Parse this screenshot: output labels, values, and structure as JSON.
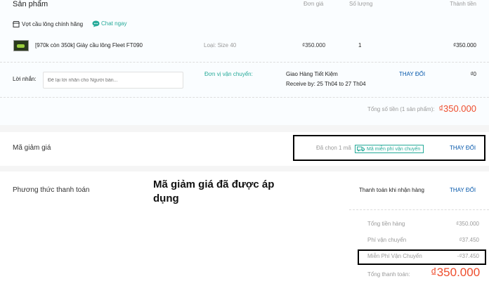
{
  "products": {
    "header": {
      "title": "Sản phẩm",
      "unit_price": "Đơn giá",
      "quantity": "Số lượng",
      "subtotal": "Thành tiền"
    },
    "shop": {
      "name": "Vợt cầu lông chính hãng",
      "chat_label": "Chat ngay"
    },
    "item": {
      "name": "[970k còn 350k] Giày cầu lông Fleet FT090",
      "variant": "Loại: Size 40",
      "price": "₫350.000",
      "quantity": "1",
      "subtotal": "₫350.000"
    },
    "message": {
      "label": "Lời nhắn:",
      "placeholder": "Để lại lời nhắn cho Người bán..."
    },
    "shipping": {
      "label": "Đơn vị vận chuyển:",
      "carrier": "Giao Hàng Tiết Kiệm",
      "eta": "Receive by: 25 Th04 to 27 Th04",
      "change_label": "THAY ĐỔI",
      "fee": "₫0"
    },
    "total": {
      "label": "Tổng số tiền (1 sản phẩm):",
      "amount": "₫350.000"
    }
  },
  "voucher": {
    "title": "Mã giảm giá",
    "selected_text": "Đã chọn 1 mã",
    "tag": "Mã miễn phí vận chuyển",
    "change_label": "THAY ĐỔI"
  },
  "payment": {
    "title": "Phương thức thanh toán",
    "method": "Thanh toán khi nhận hàng",
    "change_label": "THAY ĐỔI",
    "annotation": "Mã giảm giá đã được áp dụng",
    "summary": [
      {
        "label": "Tổng tiền hàng",
        "value": "₫350.000"
      },
      {
        "label": "Phí vận chuyển",
        "value": "₫37.450"
      },
      {
        "label": "Miễn Phí Vận Chuyển",
        "value": "-₫37.450"
      }
    ],
    "grand_total": {
      "label": "Tổng thanh toán:",
      "value": "₫350.000"
    }
  },
  "colors": {
    "accent": "#ee4d2d",
    "teal": "#26aa99",
    "link": "#0055aa"
  }
}
